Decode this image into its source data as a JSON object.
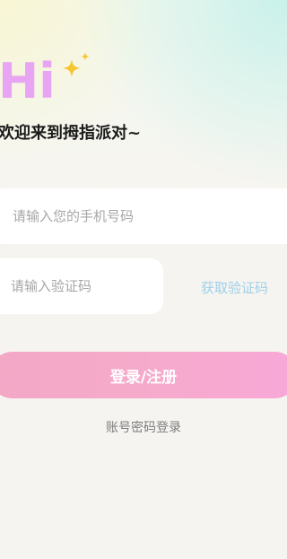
{
  "header": {
    "greeting": "Hi",
    "welcome_text": "欢迎来到拇指派对~"
  },
  "form": {
    "phone_placeholder": "请输入您的手机号码",
    "code_placeholder": "请输入验证码",
    "get_code_label": "获取验证码",
    "submit_label": "登录/注册",
    "password_login_label": "账号密码登录"
  },
  "colors": {
    "greeting": "#e8a5f3",
    "sparkle": "#f6c632",
    "get_code": "#9ed0e9",
    "button_start": "#f3a8c6",
    "button_end": "#f8a8d7"
  },
  "icons": {
    "sparkle": "sparkle-icon"
  }
}
